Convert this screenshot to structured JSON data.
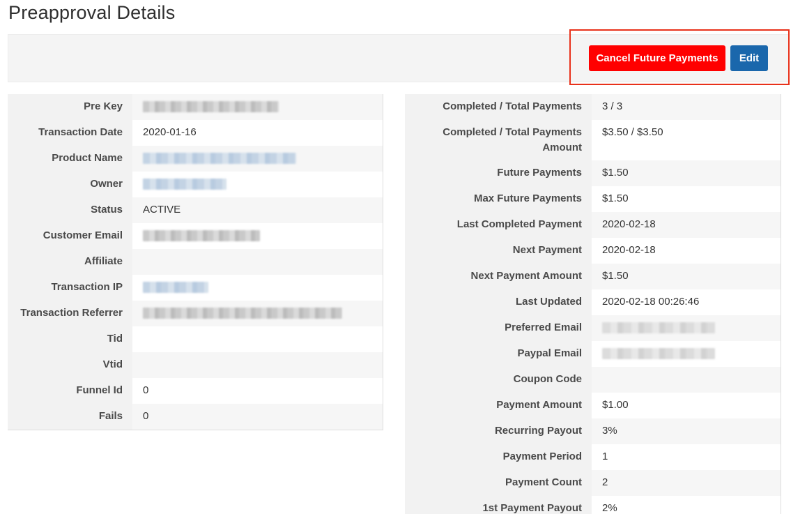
{
  "page": {
    "title": "Preapproval Details"
  },
  "toolbar": {
    "cancel_label": "Cancel Future Payments",
    "edit_label": "Edit",
    "cancel_color": "#ff0000",
    "edit_color": "#1a67ac",
    "highlight_color": "#e8311a"
  },
  "left_details": [
    {
      "label": "Pre Key",
      "value": "",
      "redacted": "gray",
      "redacted_width": 195
    },
    {
      "label": "Transaction Date",
      "value": "2020-01-16"
    },
    {
      "label": "Product Name",
      "value": "",
      "redacted": "blue",
      "redacted_width": 220
    },
    {
      "label": "Owner",
      "value": "",
      "redacted": "blue",
      "redacted_width": 120
    },
    {
      "label": "Status",
      "value": "ACTIVE"
    },
    {
      "label": "Customer Email",
      "value": "",
      "redacted": "gray",
      "redacted_width": 168
    },
    {
      "label": "Affiliate",
      "value": ""
    },
    {
      "label": "Transaction IP",
      "value": "",
      "redacted": "blue",
      "redacted_width": 94
    },
    {
      "label": "Transaction Referrer",
      "value": "",
      "redacted": "gray",
      "redacted_width": 286
    },
    {
      "label": "Tid",
      "value": ""
    },
    {
      "label": "Vtid",
      "value": ""
    },
    {
      "label": "Funnel Id",
      "value": "0"
    },
    {
      "label": "Fails",
      "value": "0"
    }
  ],
  "right_details": [
    {
      "label": "Completed / Total Payments",
      "value": "3 / 3"
    },
    {
      "label": "Completed / Total Payments Amount",
      "value": "$3.50 / $3.50"
    },
    {
      "label": "Future Payments",
      "value": "$1.50"
    },
    {
      "label": "Max Future Payments",
      "value": "$1.50"
    },
    {
      "label": "Last Completed Payment",
      "value": "2020-02-18"
    },
    {
      "label": "Next Payment",
      "value": "2020-02-18"
    },
    {
      "label": "Next Payment Amount",
      "value": "$1.50"
    },
    {
      "label": "Last Updated",
      "value": "2020-02-18 00:26:46"
    },
    {
      "label": "Preferred Email",
      "value": "",
      "redacted": "light",
      "redacted_width": 162
    },
    {
      "label": "Paypal Email",
      "value": "",
      "redacted": "light",
      "redacted_width": 162
    },
    {
      "label": "Coupon Code",
      "value": ""
    },
    {
      "label": "Payment Amount",
      "value": "$1.00"
    },
    {
      "label": "Recurring Payout",
      "value": "3%"
    },
    {
      "label": "Payment Period",
      "value": "1"
    },
    {
      "label": "Payment Count",
      "value": "2"
    },
    {
      "label": "1st Payment Payout",
      "value": "2%"
    }
  ]
}
